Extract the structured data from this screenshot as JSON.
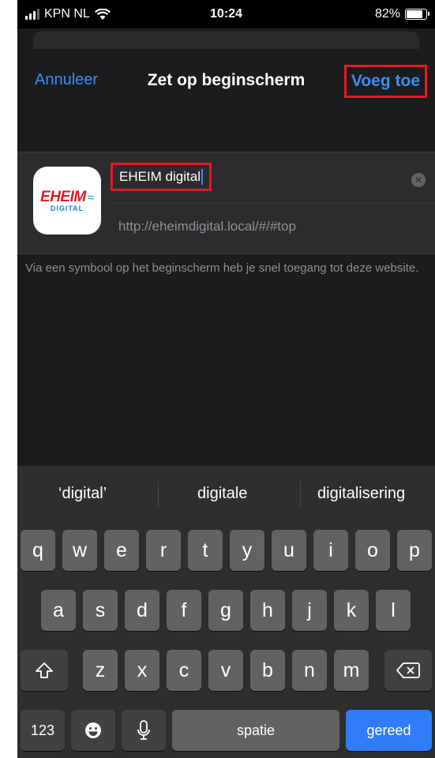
{
  "status_bar": {
    "carrier": "KPN NL",
    "time": "10:24",
    "battery": "82%"
  },
  "nav": {
    "cancel": "Annuleer",
    "title": "Zet op beginscherm",
    "add": "Voeg toe"
  },
  "bookmark": {
    "icon_logo": "EHEIM",
    "icon_sub": "DIGITAL",
    "name": "EHEIM digital",
    "url": "http://eheimdigital.local/#/#top",
    "help_text": "Via een symbool op het beginscherm heb je snel toegang tot deze website."
  },
  "keyboard": {
    "suggestions": [
      "‘digital’",
      "digitale",
      "digitalisering"
    ],
    "row1": [
      "q",
      "w",
      "e",
      "r",
      "t",
      "y",
      "u",
      "i",
      "o",
      "p"
    ],
    "row2": [
      "a",
      "s",
      "d",
      "f",
      "g",
      "h",
      "j",
      "k",
      "l"
    ],
    "row3": [
      "z",
      "x",
      "c",
      "v",
      "b",
      "n",
      "m"
    ],
    "numbers_key": "123",
    "space_key": "spatie",
    "done_key": "gereed"
  },
  "colors": {
    "accent": "#3a8ef6",
    "highlight": "#e21a26",
    "done_key": "#2f7cf6"
  }
}
